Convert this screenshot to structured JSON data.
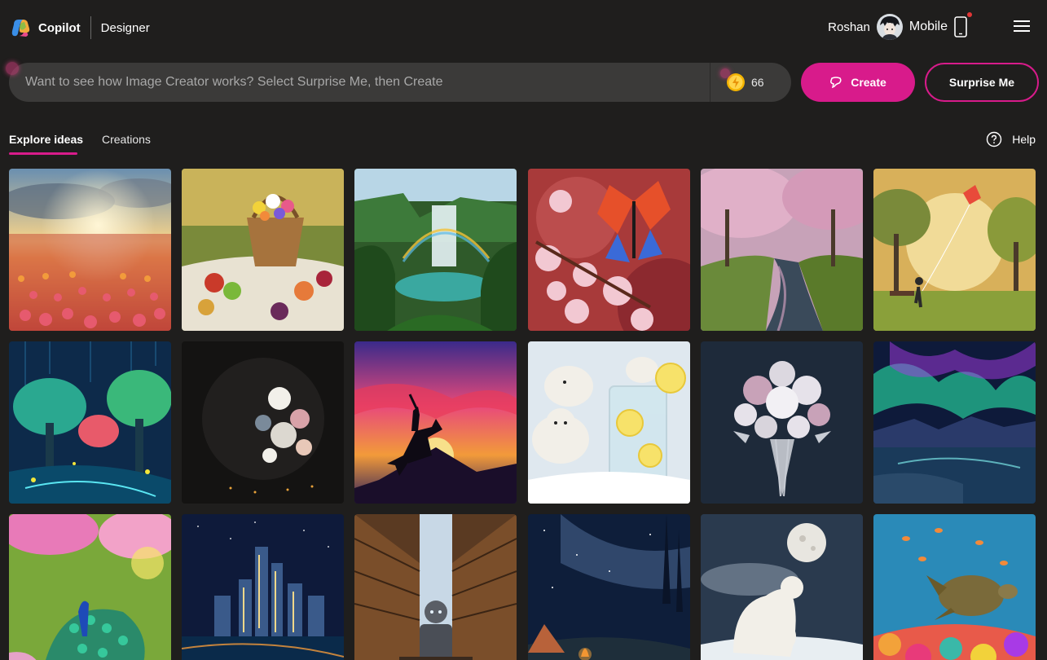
{
  "header": {
    "brand": "Copilot",
    "product": "Designer",
    "user_name": "Roshan",
    "mobile_label": "Mobile"
  },
  "prompt": {
    "placeholder": "Want to see how Image Creator works? Select Surprise Me, then Create",
    "value": "",
    "coins": "66"
  },
  "actions": {
    "create_label": "Create",
    "surprise_label": "Surprise Me"
  },
  "tabs": [
    {
      "label": "Explore ideas",
      "active": true
    },
    {
      "label": "Creations",
      "active": false
    }
  ],
  "help_label": "Help",
  "colors": {
    "accent": "#d81b8b",
    "background": "#1f1e1d",
    "input_bg": "#3b3a39"
  },
  "gallery": [
    {
      "subject": "tulip-field-sunset"
    },
    {
      "subject": "picnic-basket-flowers-fruit"
    },
    {
      "subject": "jungle-waterfall-rainbow"
    },
    {
      "subject": "butterfly-cherry-blossoms"
    },
    {
      "subject": "cherry-blossom-river-path"
    },
    {
      "subject": "child-flying-kite-park"
    },
    {
      "subject": "glowing-fantasy-forest"
    },
    {
      "subject": "crescent-moon-flowers"
    },
    {
      "subject": "horse-rider-silhouette-sunset"
    },
    {
      "subject": "polar-bears-lemonade"
    },
    {
      "subject": "silver-flower-bouquet"
    },
    {
      "subject": "aurora-over-lake"
    },
    {
      "subject": "peacock-garden"
    },
    {
      "subject": "night-city-skyline"
    },
    {
      "subject": "robot-in-library"
    },
    {
      "subject": "campfire-starry-sky"
    },
    {
      "subject": "polar-bears-full-moon"
    },
    {
      "subject": "sea-turtle-coral-reef"
    }
  ]
}
